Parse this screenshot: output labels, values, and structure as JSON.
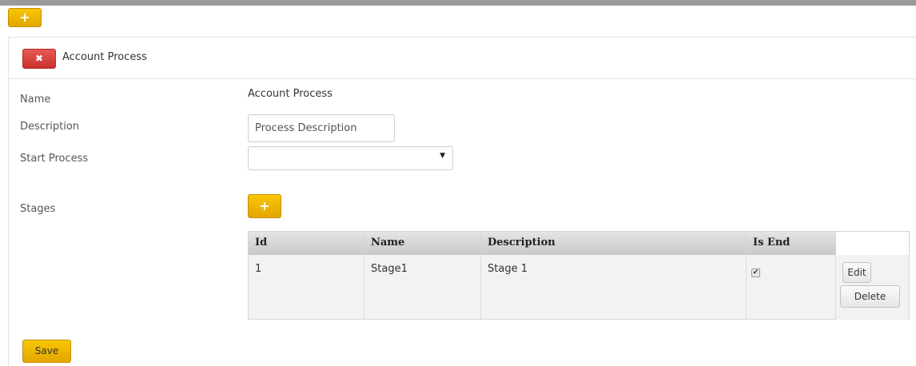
{
  "toolbar": {
    "add_label": "+"
  },
  "header": {
    "close_label": "✖",
    "title": "Account Process"
  },
  "form": {
    "name_label": "Name",
    "name_value": "Account Process",
    "description_label": "Description",
    "description_value": "Process Description",
    "start_process_label": "Start Process",
    "start_process_value": "",
    "stages_label": "Stages",
    "add_stage_label": "+"
  },
  "stages_table": {
    "columns": [
      "Id",
      "Name",
      "Description",
      "Is End"
    ],
    "rows": [
      {
        "id": "1",
        "name": "Stage1",
        "description": "Stage 1",
        "is_end": true
      }
    ],
    "checkbox_glyph": "✔",
    "edit_label": "Edit",
    "delete_label": "Delete"
  },
  "footer": {
    "save_label": "Save"
  },
  "colors": {
    "accent": "#f0b400",
    "danger": "#d9534f"
  }
}
